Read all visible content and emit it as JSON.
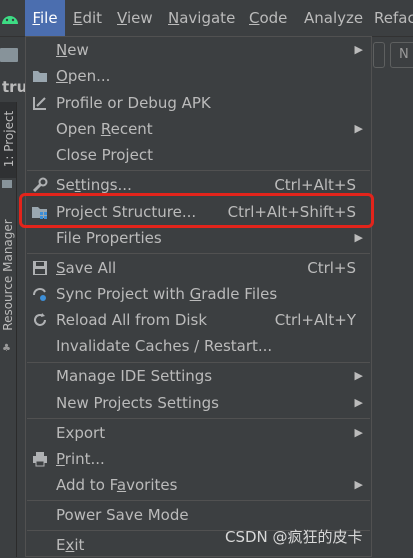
{
  "menubar": {
    "items": [
      {
        "label": "File",
        "mnemonic": "F",
        "rest": "ile"
      },
      {
        "label": "Edit",
        "mnemonic": "E",
        "rest": "dit"
      },
      {
        "label": "View",
        "mnemonic": "V",
        "rest": "iew"
      },
      {
        "label": "Navigate",
        "mnemonic": "N",
        "rest": "avigate"
      },
      {
        "label": "Code",
        "mnemonic": "C",
        "rest": "ode"
      },
      {
        "label": "Analyze",
        "mnemonic": "",
        "rest": "Analyze"
      },
      {
        "label": "Refac",
        "mnemonic": "",
        "rest": "Refac"
      }
    ]
  },
  "toolbar": {
    "partial_button": "N"
  },
  "breadcrumb": {
    "text": "tru"
  },
  "left_tabs": {
    "project": "1: Project",
    "resource": "Resource Manager"
  },
  "colors": {
    "menu_bg": "#3c3f41",
    "selected_menu": "#4b6eaf",
    "highlight_border": "#e3241b",
    "text": "#bbbbbb"
  },
  "file_menu": {
    "new": {
      "pre": "",
      "u": "N",
      "post": "ew",
      "submenu": true,
      "icon": ""
    },
    "open": {
      "pre": "",
      "u": "O",
      "post": "pen...",
      "icon": "folder-open-icon"
    },
    "profile": {
      "label": "Profile or Debug APK",
      "icon": "profile-apk-icon"
    },
    "open_recent": {
      "pre": "Open ",
      "u": "R",
      "post": "ecent",
      "submenu": true
    },
    "close_project": {
      "label": "Close Project"
    },
    "settings": {
      "pre": "Se",
      "u": "t",
      "post": "tings...",
      "shortcut": "Ctrl+Alt+S",
      "icon": "wrench-icon"
    },
    "project_structure": {
      "label": "Project Structure...",
      "shortcut": "Ctrl+Alt+Shift+S",
      "icon": "project-structure-icon"
    },
    "file_properties": {
      "label": "File Properties",
      "submenu": true
    },
    "save_all": {
      "pre": "",
      "u": "S",
      "post": "ave All",
      "shortcut": "Ctrl+S",
      "icon": "save-icon"
    },
    "sync_gradle": {
      "pre": "Sync Project with ",
      "u": "G",
      "post": "radle Files",
      "icon": "sync-gradle-icon"
    },
    "reload": {
      "label": "Reload All from Disk",
      "shortcut": "Ctrl+Alt+Y",
      "icon": "reload-icon"
    },
    "invalidate": {
      "label": "Invalidate Caches / Restart..."
    },
    "manage_ide": {
      "label": "Manage IDE Settings",
      "submenu": true
    },
    "new_projects": {
      "label": "New Projects Settings",
      "submenu": true
    },
    "export": {
      "label": "Export",
      "submenu": true
    },
    "print": {
      "pre": "",
      "u": "P",
      "post": "rint...",
      "icon": "printer-icon"
    },
    "favorites": {
      "pre": "Add to F",
      "u": "a",
      "post": "vorites",
      "submenu": true
    },
    "power_save": {
      "label": "Power Save Mode"
    },
    "exit": {
      "pre": "E",
      "u": "x",
      "post": "it"
    }
  },
  "watermark": "CSDN @疯狂的皮卡"
}
